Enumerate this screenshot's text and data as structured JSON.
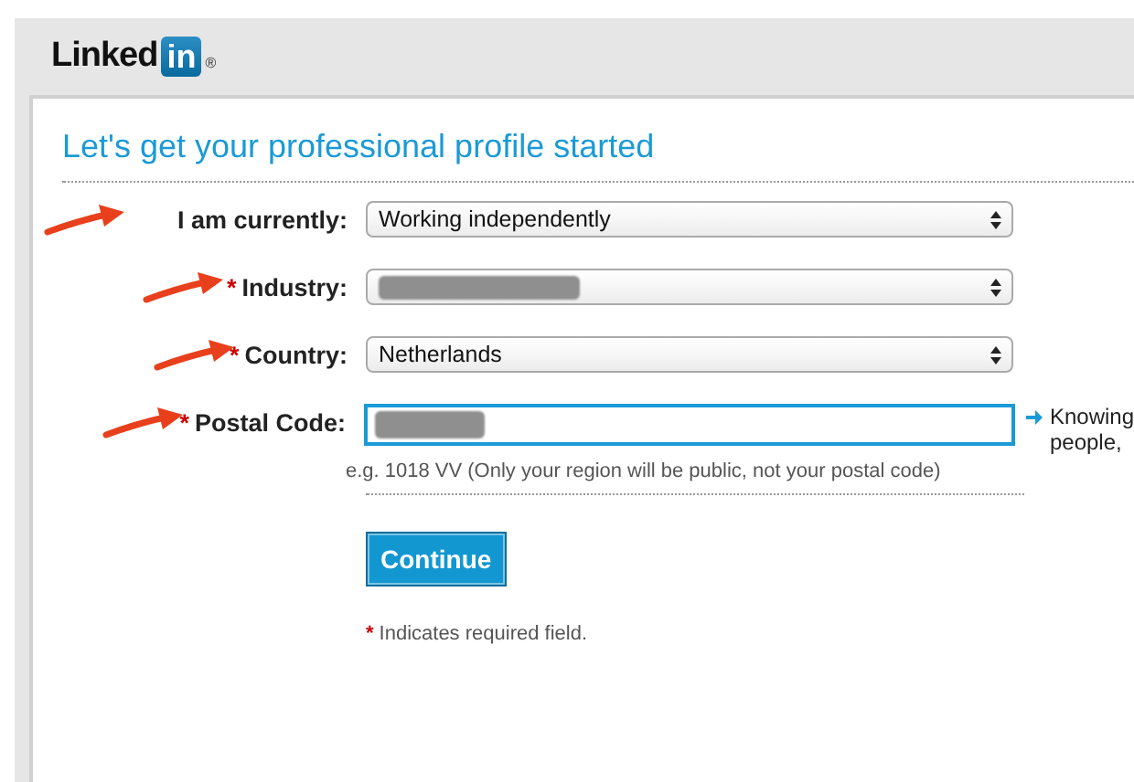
{
  "header": {
    "logo_word": "Linked",
    "logo_badge": "in",
    "logo_mark": "®"
  },
  "form": {
    "title": "Let's get your professional profile started",
    "fields": [
      {
        "kind": "select",
        "label": "I am currently:",
        "value": "Working independently",
        "redacted": false,
        "annotated": true
      },
      {
        "kind": "select",
        "required_mark": "*",
        "label": "Industry:",
        "redacted": true,
        "annotated": true
      },
      {
        "kind": "select",
        "required_mark": "*",
        "label": "Country:",
        "value": "Netherlands",
        "redacted": false,
        "annotated": true
      },
      {
        "kind": "text",
        "required_mark": "*",
        "label": "Postal Code:",
        "redacted": true,
        "annotated": true,
        "focused": true,
        "hint": "e.g. 1018 VV (Only your region will be public, not your postal code)",
        "side_note": [
          "Knowing",
          "people,"
        ]
      }
    ],
    "submit": "Continue",
    "footnote_mark": "*",
    "footnote": "Indicates required field."
  }
}
